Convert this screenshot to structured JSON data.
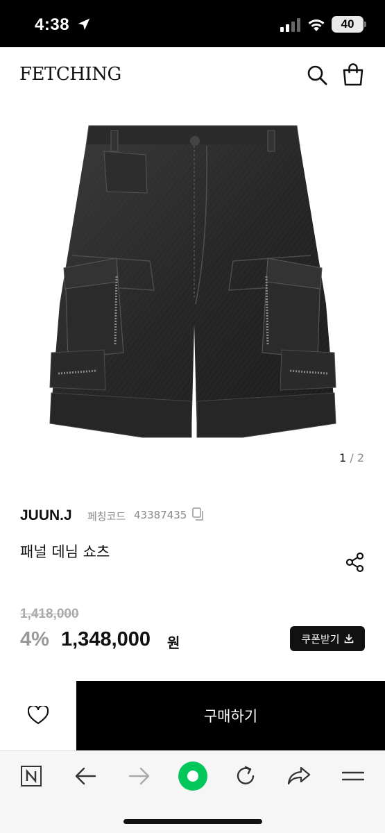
{
  "status_bar": {
    "time": "4:38",
    "battery": "40",
    "icons": [
      "location-arrow-icon",
      "cellular-signal-icon",
      "wifi-icon",
      "battery-icon"
    ]
  },
  "header": {
    "logo": "FETCHING",
    "icons": [
      "search-icon",
      "shopping-bag-icon"
    ]
  },
  "gallery": {
    "current": "1",
    "separator": "/",
    "total": "2"
  },
  "product": {
    "brand": "JUUN.J",
    "code_label": "페칭코드",
    "code_value": "43387435",
    "name": "패널 데님 쇼츠",
    "original_price": "1,418,000",
    "discount": "4%",
    "sale_price": "1,348,000",
    "currency": "원",
    "coupon_label": "쿠폰받기"
  },
  "purchase_bar": {
    "buy_label": "구매하기"
  },
  "browser_toolbar": {
    "items": [
      "naver-n-icon",
      "back-arrow-icon",
      "forward-arrow-icon",
      "green-circle-icon",
      "reload-icon",
      "share-arrow-icon",
      "menu-icon"
    ]
  },
  "colors": {
    "background": "#ffffff",
    "primary": "#111111",
    "muted": "#8a8a8a",
    "strike": "#aaaaaa",
    "green_accent": "#03c75a"
  }
}
